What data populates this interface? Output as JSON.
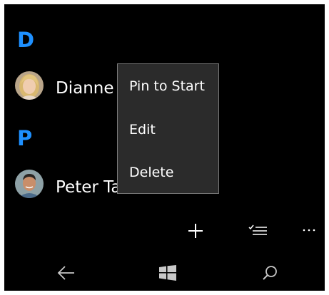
{
  "groups": [
    {
      "letter": "D",
      "contact": {
        "name": "Dianne",
        "avatar_icon": "female-avatar-icon"
      }
    },
    {
      "letter": "P",
      "contact": {
        "name": "Peter Ta",
        "avatar_icon": "male-avatar-icon"
      }
    }
  ],
  "context_menu": {
    "items": [
      "Pin to Start",
      "Edit",
      "Delete"
    ]
  },
  "command_bar": {
    "icons": [
      "add-icon",
      "select-list-icon",
      "more-icon"
    ]
  },
  "nav_bar": {
    "icons": [
      "back-arrow-icon",
      "windows-start-icon",
      "search-icon"
    ]
  },
  "colors": {
    "accent": "#1e90ff",
    "background": "#000000",
    "menu_background": "#2b2b2b",
    "menu_border": "#7a7a7a",
    "text": "#ffffff"
  }
}
